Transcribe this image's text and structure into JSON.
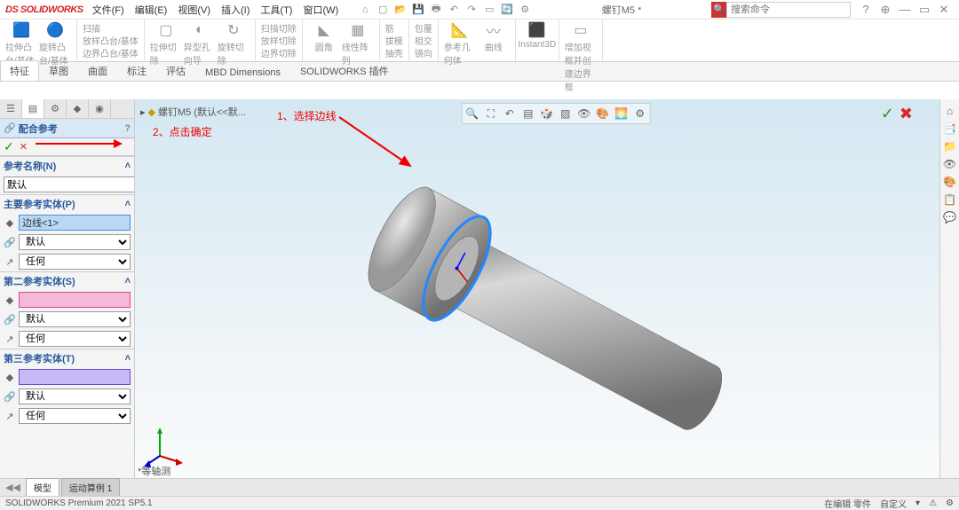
{
  "app": {
    "name": "SOLIDWORKS",
    "title": "螺钉M5 *",
    "search_placeholder": "搜索命令"
  },
  "menus": [
    "文件(F)",
    "编辑(E)",
    "视图(V)",
    "插入(I)",
    "工具(T)",
    "窗口(W)"
  ],
  "tabs": [
    "特征",
    "草图",
    "曲面",
    "标注",
    "评估",
    "MBD Dimensions",
    "SOLIDWORKS 插件"
  ],
  "active_tab": "特征",
  "ribbon": {
    "groups": [
      {
        "items": [
          {
            "icon": "🟦",
            "label": "拉伸凸台/基体"
          },
          {
            "icon": "🔵",
            "label": "旋转凸台/基体"
          }
        ]
      },
      {
        "items": [
          {
            "icon": "↯",
            "label": "扫描"
          },
          {
            "icon": "◈",
            "label": "放样凸台/基体"
          },
          {
            "icon": "◉",
            "label": "边界凸台/基体"
          }
        ]
      },
      {
        "items": [
          {
            "icon": "▢",
            "label": "拉伸切除"
          },
          {
            "icon": "◐",
            "label": "异型孔向导"
          },
          {
            "icon": "↻",
            "label": "旋转切除"
          }
        ]
      },
      {
        "items": [
          {
            "icon": "↯",
            "label": "扫描切除"
          },
          {
            "icon": "◈",
            "label": "放样切除"
          },
          {
            "icon": "◉",
            "label": "边界切除"
          }
        ]
      },
      {
        "items": [
          {
            "icon": "◣",
            "label": "圆角"
          },
          {
            "icon": "▦",
            "label": "线性阵列"
          }
        ]
      },
      {
        "items": [
          {
            "icon": "◢",
            "label": "筋"
          },
          {
            "icon": "◐",
            "label": "拔模"
          },
          {
            "icon": "▭",
            "label": "抽壳"
          }
        ]
      },
      {
        "items": [
          {
            "icon": "⊞",
            "label": "包覆"
          },
          {
            "icon": "⊕",
            "label": "相交"
          },
          {
            "icon": "▲",
            "label": "镜向"
          }
        ]
      },
      {
        "items": [
          {
            "icon": "📐",
            "label": "参考几何体"
          },
          {
            "icon": "〰",
            "label": "曲线"
          }
        ]
      },
      {
        "items": [
          {
            "icon": "⬛",
            "label": "Instant3D"
          }
        ]
      },
      {
        "items": [
          {
            "icon": "▭",
            "label": "增加视框并创建边界框"
          }
        ]
      }
    ]
  },
  "breadcrumb": {
    "part": "螺钉M5",
    "config": "(默认<<默..."
  },
  "pm": {
    "title": "配合参考",
    "ref_name_label": "参考名称(N)",
    "ref_name_value": "默认",
    "primary": {
      "title": "主要参考实体(P)",
      "entity": "边线<1>",
      "type": "默认",
      "align": "任何"
    },
    "secondary": {
      "title": "第二参考实体(S)",
      "entity": "",
      "type": "默认",
      "align": "任何"
    },
    "tertiary": {
      "title": "第三参考实体(T)",
      "entity": "",
      "type": "默认",
      "align": "任何"
    }
  },
  "annotations": {
    "a1": "1、选择边线",
    "a2": "2、点击确定"
  },
  "triad_label": "*等轴测",
  "bottom_tabs": [
    "模型",
    "运动算例 1"
  ],
  "status": {
    "left": "SOLIDWORKS Premium 2021 SP5.1",
    "mode": "在编辑 零件",
    "custom": "自定义"
  }
}
